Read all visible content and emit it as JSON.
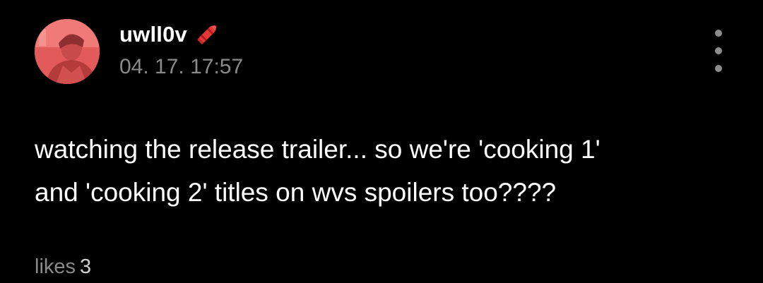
{
  "post": {
    "author": {
      "username": "uwll0v",
      "badge_icon": "crayon-icon",
      "avatar_tint": "#e65b5b"
    },
    "timestamp": "04. 17. 17:57",
    "menu_icon": "more-vertical-icon",
    "body_lines": [
      "watching the release trailer... so we're 'cooking 1'",
      "and 'cooking 2' titles on wvs spoilers too????"
    ],
    "likes": {
      "label": "likes",
      "count": "3"
    }
  },
  "colors": {
    "background": "#000000",
    "text_primary": "#ffffff",
    "text_secondary": "#8a8a8a",
    "accent_red": "#e53935"
  }
}
